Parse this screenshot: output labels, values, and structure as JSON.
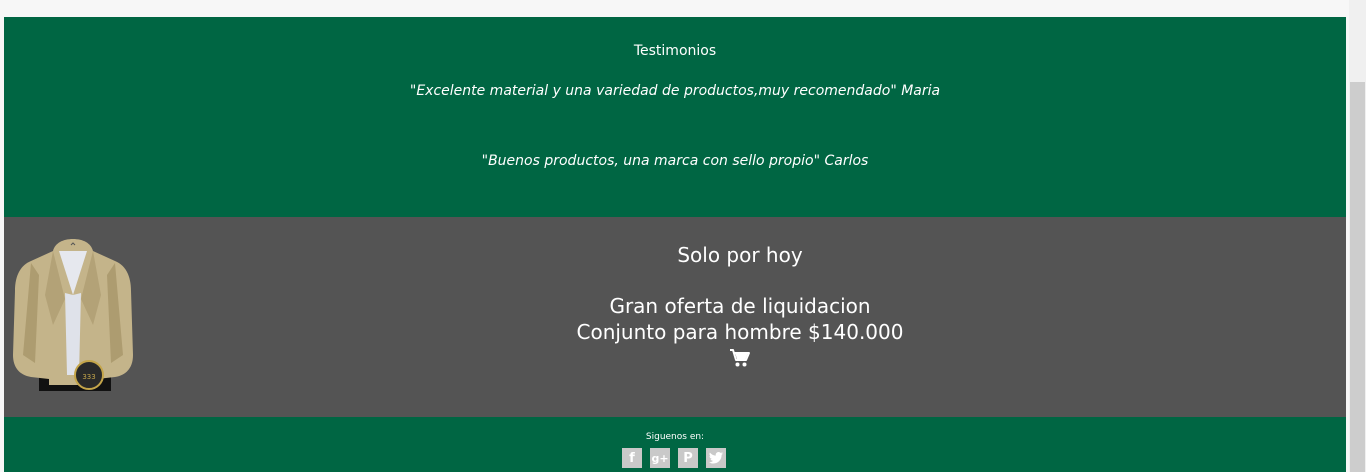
{
  "testimonials": {
    "title": "Testimonios",
    "quotes": [
      "\"Excelente material y una variedad de productos,muy recomendado\" Maria",
      "\"Buenos productos, una marca con sello propio\" Carlos"
    ]
  },
  "offer": {
    "headline": "Solo por hoy",
    "line1": "Gran oferta de liquidacion",
    "line2": "Conjunto para hombre $140.000",
    "cart_icon": "shopping-cart-icon",
    "image": "beige-blazer-image"
  },
  "footer": {
    "follow_label": "Siguenos en:",
    "social_icons": [
      "facebook-icon",
      "google-plus-icon",
      "pinterest-icon",
      "twitter-icon"
    ]
  },
  "colors": {
    "green": "#006643",
    "gray": "#545454",
    "social_bg": "#c9c9c9"
  }
}
